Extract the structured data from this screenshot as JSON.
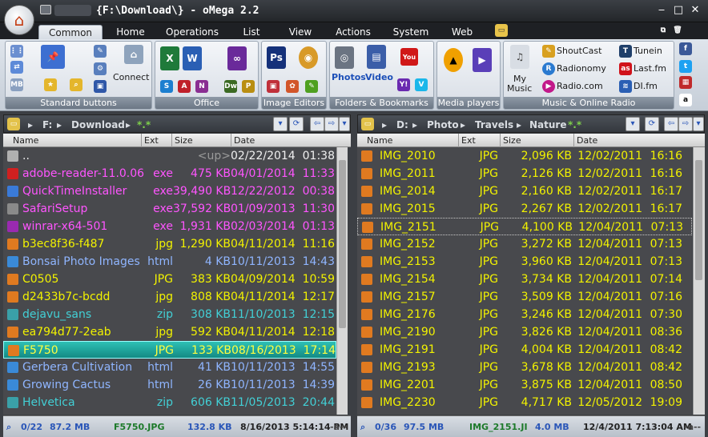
{
  "window": {
    "title": "{F:\\Download\\} - oMega 2.2",
    "minimize": "‒",
    "maximize": "□",
    "close": "✕"
  },
  "tabs": [
    "Common",
    "Home",
    "Operations",
    "List",
    "View",
    "Actions",
    "System",
    "Web"
  ],
  "active_tab": "Common",
  "ribbon": {
    "groups": [
      "Standard buttons",
      "Office",
      "Image Editors",
      "Folders & Bookmarks",
      "Media players",
      "Music & Online Radio"
    ],
    "connect_label": "Connect",
    "photos_label": "Photos",
    "video_label": "Video",
    "my_music_label_1": "My",
    "my_music_label_2": "Music",
    "radio_links": [
      "ShoutCast",
      "Tunein",
      "Radionomy",
      "Last.fm",
      "Radio.com",
      "DI.fm"
    ]
  },
  "left_panel": {
    "path": [
      "F:",
      "Download",
      "*.*"
    ],
    "columns": [
      "Name",
      "Ext",
      "Size",
      "Date"
    ],
    "rows": [
      {
        "name": "..",
        "ext": "",
        "size": "<up>",
        "date": "02/22/2014",
        "time": "01:38",
        "color": "#f0f0f0",
        "icon": "up-icon"
      },
      {
        "name": "adobe-reader-11.0.06",
        "ext": "exe",
        "size": "475 KB",
        "date": "04/01/2014",
        "time": "11:33",
        "color": "#ff55ff",
        "icon": "pdf-icon"
      },
      {
        "name": "QuickTimeInstaller",
        "ext": "exe",
        "size": "39,490 KB",
        "date": "12/22/2012",
        "time": "00:38",
        "color": "#ff55ff",
        "icon": "quicktime-icon"
      },
      {
        "name": "SafariSetup",
        "ext": "exe",
        "size": "37,592 KB",
        "date": "01/09/2013",
        "time": "11:30",
        "color": "#ff55ff",
        "icon": "installer-icon"
      },
      {
        "name": "winrar-x64-501",
        "ext": "exe",
        "size": "1,931 KB",
        "date": "02/03/2014",
        "time": "01:13",
        "color": "#ff55ff",
        "icon": "winrar-icon"
      },
      {
        "name": "b3ec8f36-f487",
        "ext": "jpg",
        "size": "1,290 KB",
        "date": "04/11/2014",
        "time": "11:16",
        "color": "#f2f200",
        "icon": "image-icon"
      },
      {
        "name": "Bonsai Photo Images",
        "ext": "html",
        "size": "4 KB",
        "date": "10/11/2013",
        "time": "14:43",
        "color": "#8fb5ff",
        "icon": "html-icon"
      },
      {
        "name": "C0505",
        "ext": "JPG",
        "size": "383 KB",
        "date": "04/09/2014",
        "time": "10:59",
        "color": "#f2f200",
        "icon": "image-icon"
      },
      {
        "name": "d2433b7c-bcdd",
        "ext": "jpg",
        "size": "808 KB",
        "date": "04/11/2014",
        "time": "12:17",
        "color": "#f2f200",
        "icon": "image-icon"
      },
      {
        "name": "dejavu_sans",
        "ext": "zip",
        "size": "308 KB",
        "date": "11/10/2013",
        "time": "12:15",
        "color": "#42d0d6",
        "icon": "zip-icon"
      },
      {
        "name": "ea794d77-2eab",
        "ext": "jpg",
        "size": "592 KB",
        "date": "04/11/2014",
        "time": "12:18",
        "color": "#f2f200",
        "icon": "image-icon"
      },
      {
        "name": "F5750",
        "ext": "JPG",
        "size": "133 KB",
        "date": "08/16/2013",
        "time": "17:14",
        "color": "#f2f200",
        "icon": "image-icon",
        "selected": true
      },
      {
        "name": "Gerbera Cultivation",
        "ext": "html",
        "size": "41 KB",
        "date": "10/11/2013",
        "time": "14:55",
        "color": "#8fb5ff",
        "icon": "html-icon"
      },
      {
        "name": "Growing Cactus",
        "ext": "html",
        "size": "26 KB",
        "date": "10/11/2013",
        "time": "14:39",
        "color": "#8fb5ff",
        "icon": "html-icon"
      },
      {
        "name": "Helvetica",
        "ext": "zip",
        "size": "606 KB",
        "date": "11/05/2013",
        "time": "20:44",
        "color": "#42d0d6",
        "icon": "zip-icon"
      }
    ],
    "status": {
      "count": "0/22",
      "total": "87.2 MB",
      "file": "F5750.JPG",
      "size": "132.8 KB",
      "date": "8/16/2013 5:14:14 PM",
      "attr": "-a--"
    },
    "scroll_position": 0.0
  },
  "right_panel": {
    "path": [
      "D:",
      "Photo",
      "Travels",
      "Nature",
      "*.*"
    ],
    "columns": [
      "Name",
      "Ext",
      "Size",
      "Date"
    ],
    "rows": [
      {
        "name": "IMG_2010",
        "ext": "JPG",
        "size": "2,096 KB",
        "date": "12/02/2011",
        "time": "16:16"
      },
      {
        "name": "IMG_2011",
        "ext": "JPG",
        "size": "2,126 KB",
        "date": "12/02/2011",
        "time": "16:16"
      },
      {
        "name": "IMG_2014",
        "ext": "JPG",
        "size": "2,160 KB",
        "date": "12/02/2011",
        "time": "16:17"
      },
      {
        "name": "IMG_2015",
        "ext": "JPG",
        "size": "2,267 KB",
        "date": "12/02/2011",
        "time": "16:17"
      },
      {
        "name": "IMG_2151",
        "ext": "JPG",
        "size": "4,100 KB",
        "date": "12/04/2011",
        "time": "07:13",
        "focused": true
      },
      {
        "name": "IMG_2152",
        "ext": "JPG",
        "size": "3,272 KB",
        "date": "12/04/2011",
        "time": "07:13"
      },
      {
        "name": "IMG_2153",
        "ext": "JPG",
        "size": "3,960 KB",
        "date": "12/04/2011",
        "time": "07:13"
      },
      {
        "name": "IMG_2154",
        "ext": "JPG",
        "size": "3,734 KB",
        "date": "12/04/2011",
        "time": "07:14"
      },
      {
        "name": "IMG_2157",
        "ext": "JPG",
        "size": "3,509 KB",
        "date": "12/04/2011",
        "time": "07:16"
      },
      {
        "name": "IMG_2176",
        "ext": "JPG",
        "size": "3,246 KB",
        "date": "12/04/2011",
        "time": "07:30"
      },
      {
        "name": "IMG_2190",
        "ext": "JPG",
        "size": "3,826 KB",
        "date": "12/04/2011",
        "time": "08:36"
      },
      {
        "name": "IMG_2191",
        "ext": "JPG",
        "size": "4,004 KB",
        "date": "12/04/2011",
        "time": "08:42"
      },
      {
        "name": "IMG_2193",
        "ext": "JPG",
        "size": "3,678 KB",
        "date": "12/04/2011",
        "time": "08:42"
      },
      {
        "name": "IMG_2201",
        "ext": "JPG",
        "size": "3,875 KB",
        "date": "12/04/2011",
        "time": "08:50"
      },
      {
        "name": "IMG_2230",
        "ext": "JPG",
        "size": "4,717 KB",
        "date": "12/05/2012",
        "time": "19:09"
      }
    ],
    "status": {
      "count": "0/36",
      "total": "97.5 MB",
      "file": "IMG_2151.JI",
      "size": "4.0 MB",
      "date": "12/4/2011 7:13:04 AM",
      "attr": "-a--"
    }
  },
  "colors": {
    "file_yellow": "#f2f200",
    "exe_magenta": "#ff55ff",
    "html_blue": "#8fb5ff",
    "zip_cyan": "#42d0d6",
    "selection_teal": "#1ca59d",
    "list_bg": "#48494d"
  }
}
